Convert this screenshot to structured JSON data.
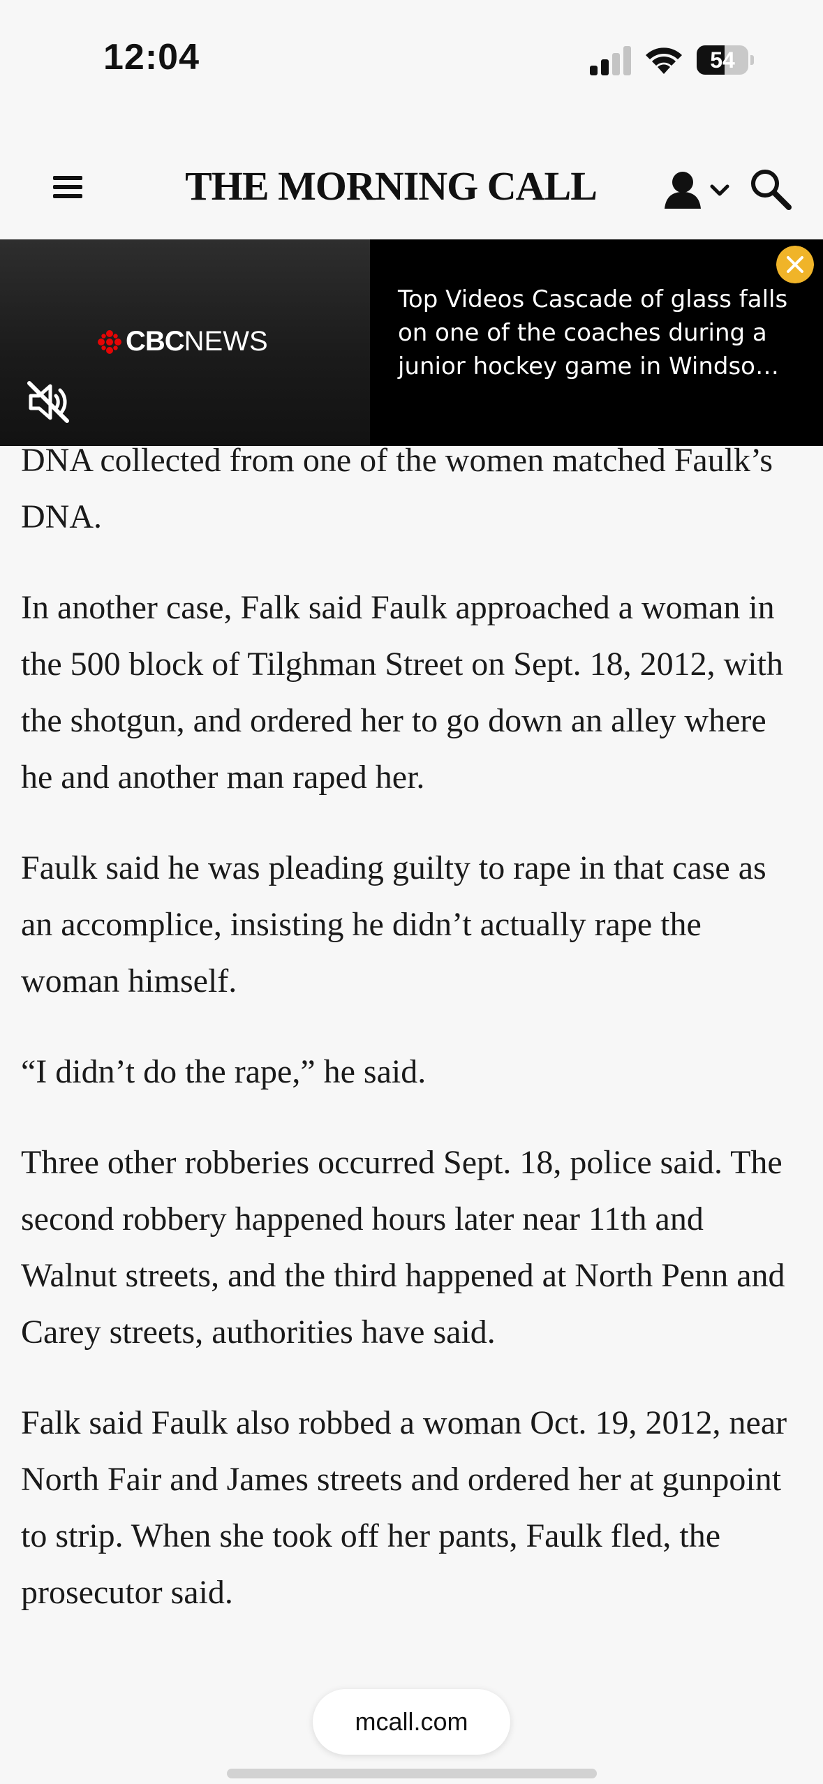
{
  "status_bar": {
    "time": "12:04",
    "battery_percent": "54",
    "battery_level": 0.54,
    "signal_bars_active": 2,
    "icons": [
      "cellular-signal-icon",
      "wifi-icon",
      "battery-icon"
    ]
  },
  "header": {
    "masthead": "THE MORNING CALL",
    "icons": [
      "hamburger-menu-icon",
      "account-icon",
      "chevron-down-icon",
      "search-icon"
    ]
  },
  "video_ad": {
    "brand_bold": "CBC",
    "brand_regular": "NEWS",
    "title": "Top Videos Cascade of glass falls on one of the coaches during a junior hockey game in Windso…",
    "accent_color": "#f0b429",
    "icons": [
      "cbc-gem-icon",
      "mute-icon",
      "close-icon"
    ]
  },
  "article": {
    "paragraphs": [
      "DNA collected from one of the women matched Faulk’s DNA.",
      "In another case, Falk said Faulk approached a woman in the 500 block of Tilghman Street on Sept. 18, 2012, with the shotgun, and ordered her to go down an alley where he and another man raped her.",
      "Faulk said he was pleading guilty to rape in that case as an accomplice, insisting he didn’t actually rape the woman himself.",
      "“I didn’t do the rape,” he said.",
      "Three other robberies occurred Sept. 18, police said. The second robbery happened hours later near 11th and Walnut streets, and the third happened at North Penn and Carey streets, authorities have said.",
      "Falk said Faulk also robbed a woman Oct. 19, 2012, near North Fair and James streets and ordered her at gunpoint to strip. When she took off her pants, Faulk fled, the prosecutor said."
    ]
  },
  "browser": {
    "url": "mcall.com"
  }
}
